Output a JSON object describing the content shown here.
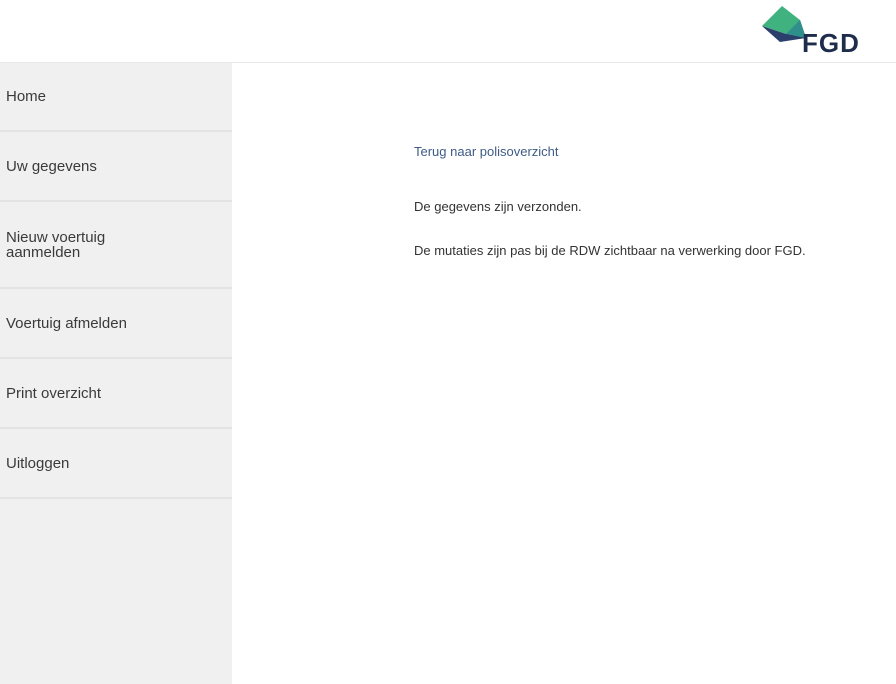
{
  "brand": {
    "logo_text": "FGD",
    "colors": {
      "dark": "#1f2d4c",
      "green": "#3fb27f",
      "navy": "#2a3f6b",
      "teal": "#2f8f8a"
    }
  },
  "sidebar": {
    "items": [
      {
        "label": "Home"
      },
      {
        "label": "Uw gegevens"
      },
      {
        "label": "Nieuw voertuig\naanmelden"
      },
      {
        "label": "Voertuig afmelden"
      },
      {
        "label": "Print overzicht"
      },
      {
        "label": "Uitloggen"
      }
    ]
  },
  "main": {
    "back_link": "Terug naar polisoverzicht",
    "message_sent": "De gegevens zijn verzonden.",
    "message_note": "De mutaties zijn pas bij de RDW zichtbaar na verwerking door FGD."
  }
}
